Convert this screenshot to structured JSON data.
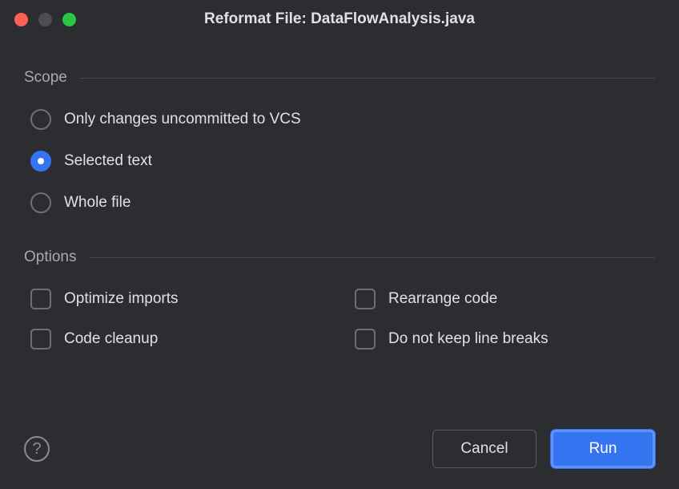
{
  "title": "Reformat File: DataFlowAnalysis.java",
  "scope": {
    "heading": "Scope",
    "options": [
      {
        "label": "Only changes uncommitted to VCS",
        "selected": false
      },
      {
        "label": "Selected text",
        "selected": true
      },
      {
        "label": "Whole file",
        "selected": false
      }
    ]
  },
  "options": {
    "heading": "Options",
    "items": [
      {
        "label": "Optimize imports",
        "checked": false
      },
      {
        "label": "Rearrange code",
        "checked": false
      },
      {
        "label": "Code cleanup",
        "checked": false
      },
      {
        "label": "Do not keep line breaks",
        "checked": false
      }
    ]
  },
  "buttons": {
    "cancel": "Cancel",
    "run": "Run"
  }
}
